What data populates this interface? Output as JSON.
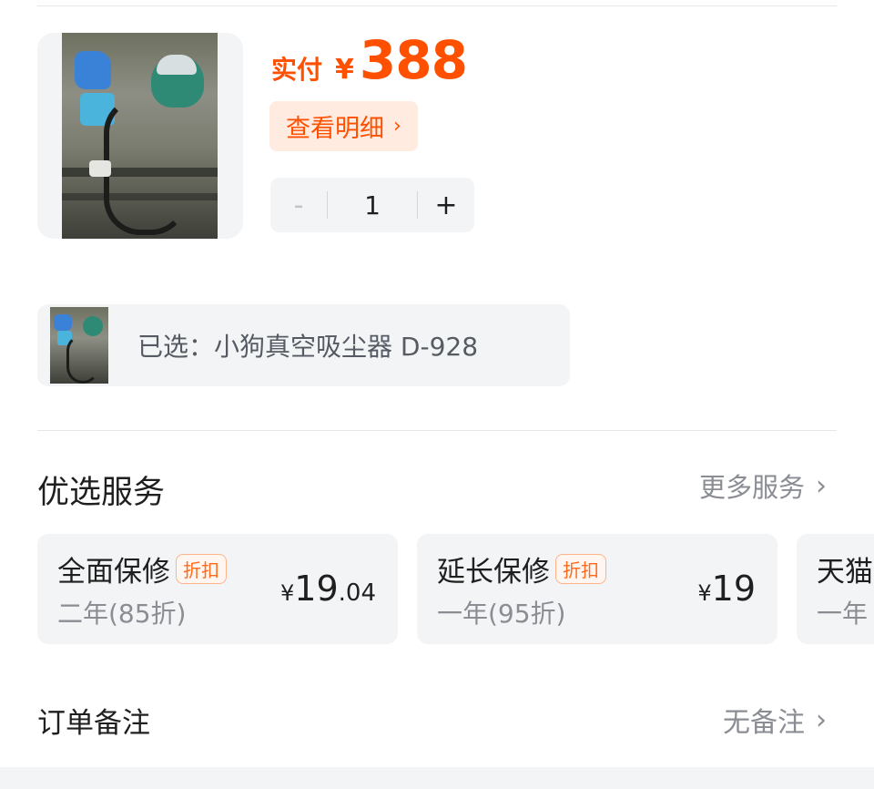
{
  "product": {
    "price_prefix": "实付",
    "currency": "¥",
    "price": "388",
    "detail_label": "查看明细",
    "quantity": "1",
    "minus_label": "-",
    "plus_label": "+"
  },
  "selection": {
    "label": "已选：小狗真空吸尘器 D-928"
  },
  "services": {
    "title": "优选服务",
    "more_label": "更多服务",
    "items": [
      {
        "name": "全面保修",
        "tag": "折扣",
        "desc": "二年(85折)",
        "currency": "¥",
        "price_int": "19",
        "price_dec": ".04"
      },
      {
        "name": "延长保修",
        "tag": "折扣",
        "desc": "一年(95折)",
        "currency": "¥",
        "price_int": "19",
        "price_dec": ""
      },
      {
        "name": "天猫",
        "tag": "",
        "desc": "一年",
        "currency": "",
        "price_int": "",
        "price_dec": ""
      }
    ]
  },
  "order_note": {
    "label": "订单备注",
    "value": "无备注"
  },
  "colors": {
    "accent": "#ff5000",
    "accent_bg": "#ffebe0",
    "card_bg": "#f3f4f6"
  },
  "icons": {
    "chevron": "chevron-right-icon"
  }
}
